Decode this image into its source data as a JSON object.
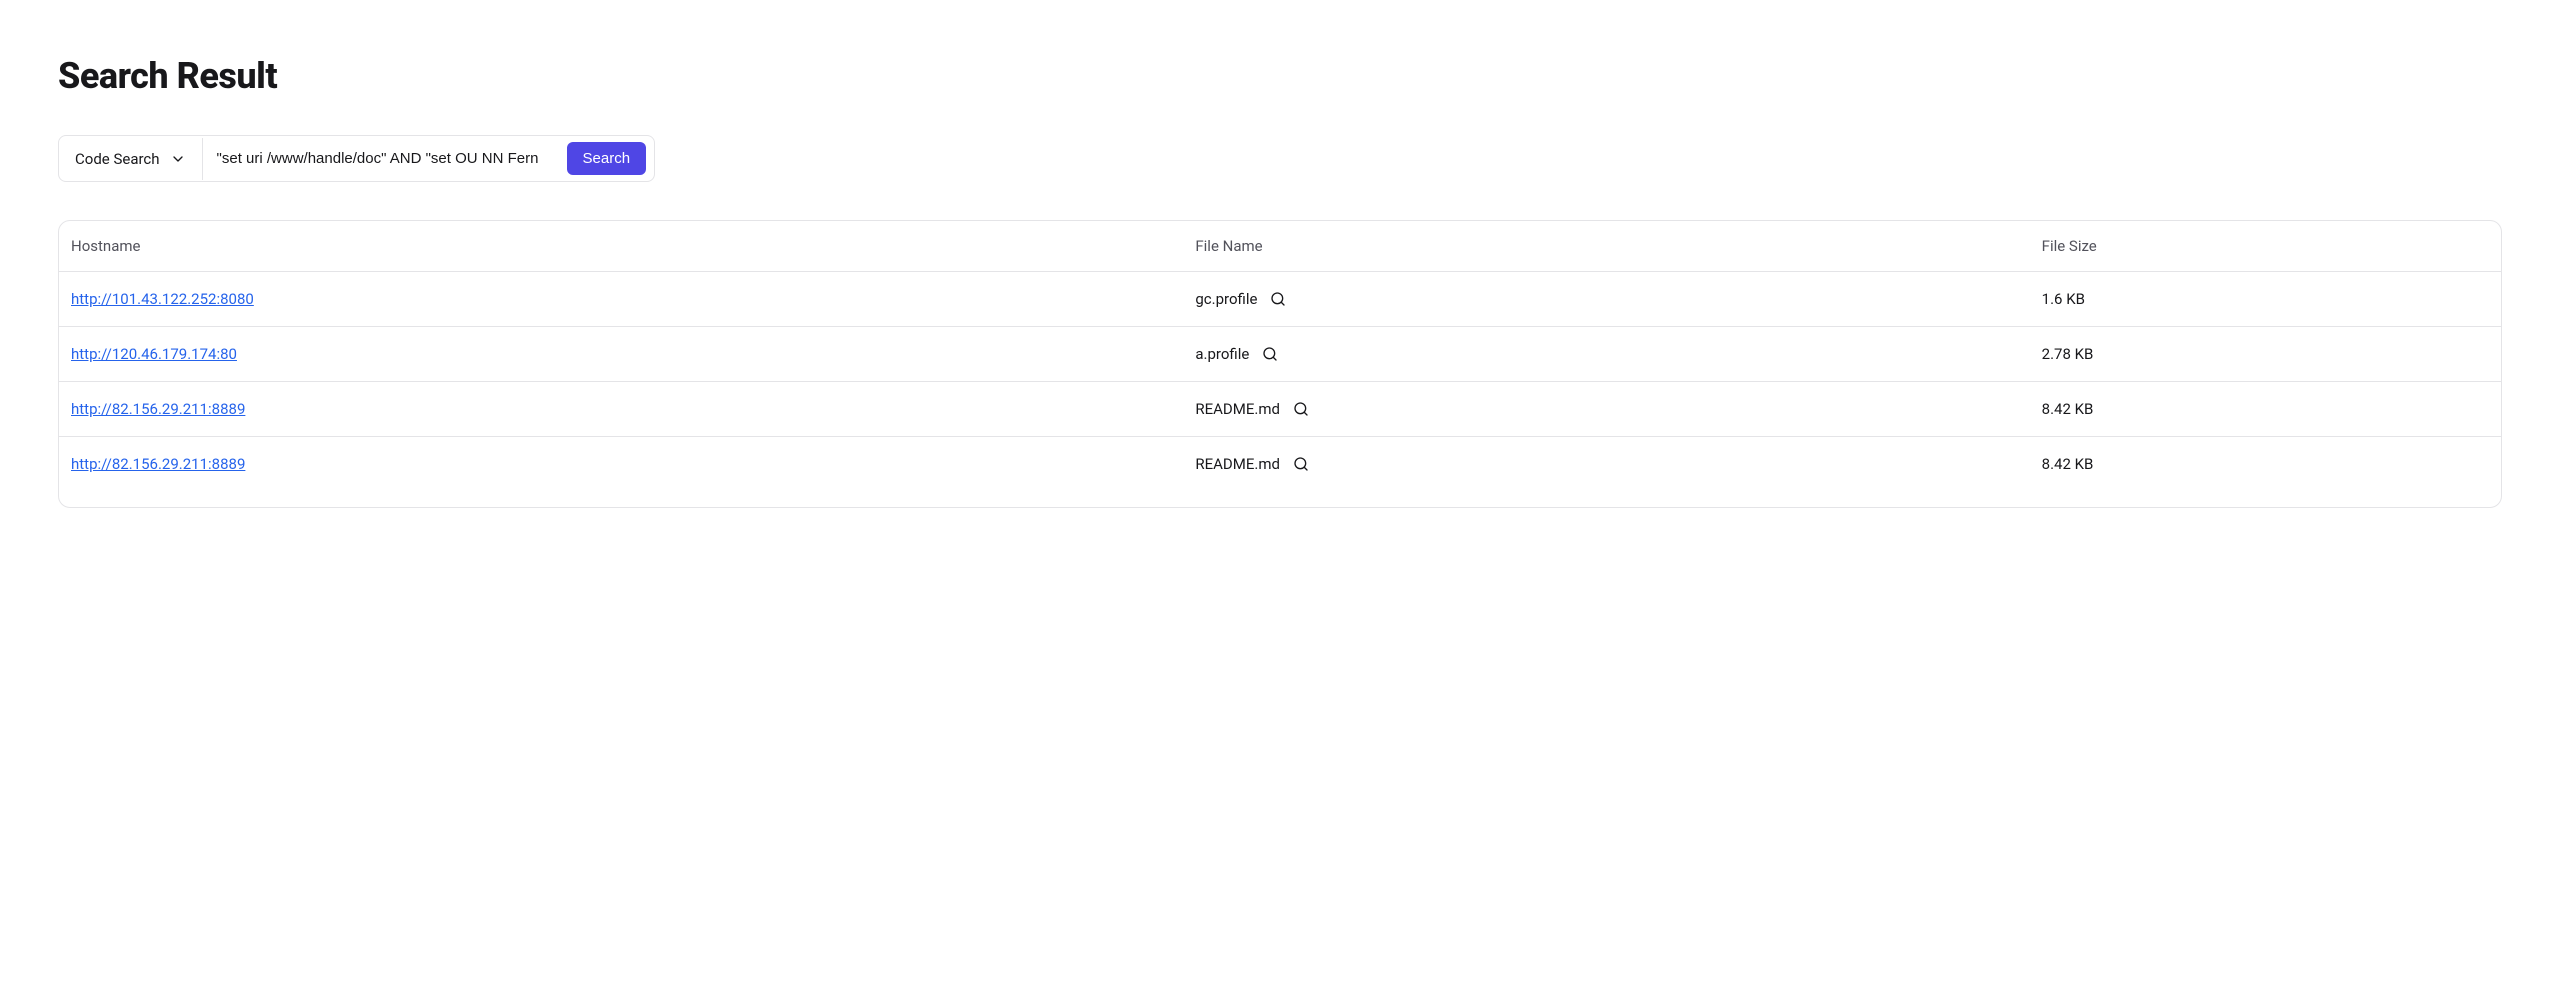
{
  "page": {
    "title": "Search Result"
  },
  "search": {
    "type_label": "Code Search",
    "input_value": "\"set uri /www/handle/doc\" AND \"set OU NN Fern",
    "button_label": "Search"
  },
  "table": {
    "headers": {
      "hostname": "Hostname",
      "filename": "File Name",
      "filesize": "File Size"
    },
    "rows": [
      {
        "hostname": "http://101.43.122.252:8080",
        "filename": "gc.profile",
        "filesize": "1.6 KB"
      },
      {
        "hostname": "http://120.46.179.174:80",
        "filename": "a.profile",
        "filesize": "2.78 KB"
      },
      {
        "hostname": "http://82.156.29.211:8889",
        "filename": "README.md",
        "filesize": "8.42 KB"
      },
      {
        "hostname": "http://82.156.29.211:8889",
        "filename": "README.md",
        "filesize": "8.42 KB"
      }
    ]
  }
}
